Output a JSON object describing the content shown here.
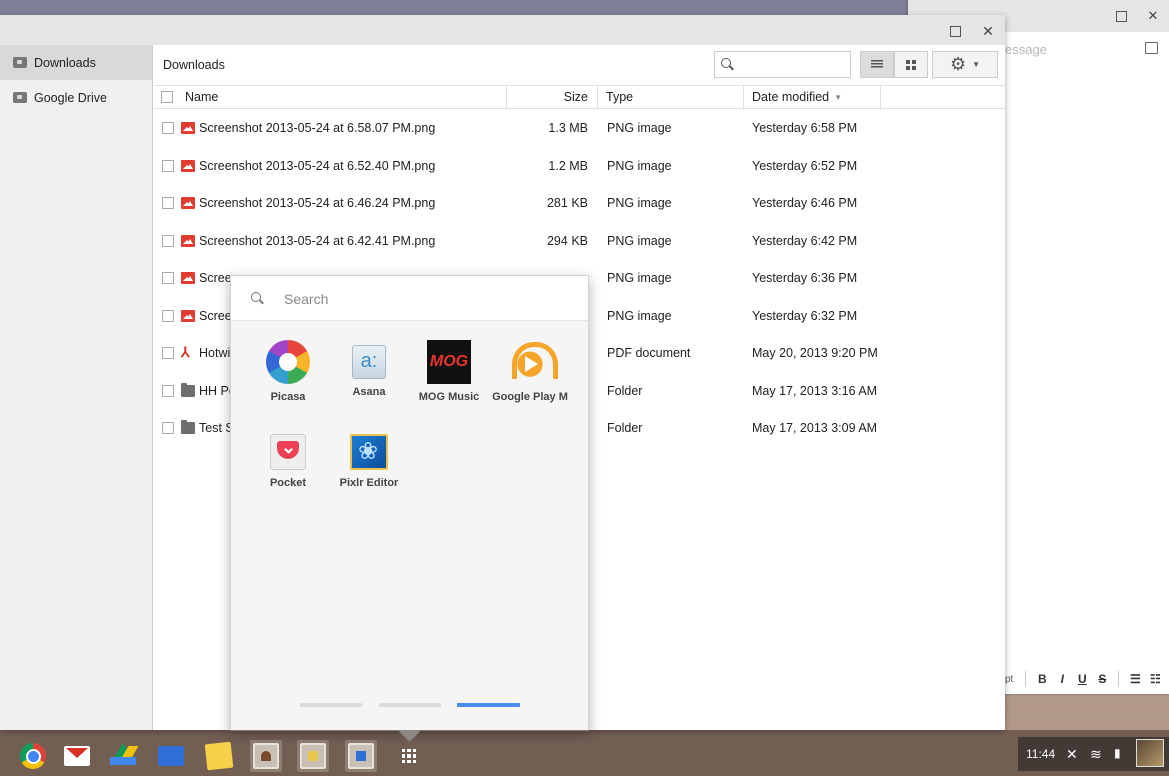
{
  "compose_window": {
    "placeholder": "essage",
    "font_size_label": "pt",
    "format_buttons": [
      "B",
      "I",
      "U",
      "S"
    ]
  },
  "file_manager": {
    "sidebar": {
      "items": [
        {
          "label": "Downloads",
          "active": true,
          "icon": "download-folder-icon"
        },
        {
          "label": "Google Drive",
          "active": false,
          "icon": "drive-folder-icon"
        }
      ]
    },
    "breadcrumb": "Downloads",
    "search": {
      "value": "",
      "placeholder": ""
    },
    "columns": {
      "name": "Name",
      "size": "Size",
      "type": "Type",
      "date": "Date modified"
    },
    "files": [
      {
        "name": "Screenshot 2013-05-24 at 6.58.07 PM.png",
        "size": "1.3 MB",
        "type": "PNG image",
        "date": "Yesterday 6:58 PM",
        "icon": "image"
      },
      {
        "name": "Screenshot 2013-05-24 at 6.52.40 PM.png",
        "size": "1.2 MB",
        "type": "PNG image",
        "date": "Yesterday 6:52 PM",
        "icon": "image"
      },
      {
        "name": "Screenshot 2013-05-24 at 6.46.24 PM.png",
        "size": "281 KB",
        "type": "PNG image",
        "date": "Yesterday 6:46 PM",
        "icon": "image"
      },
      {
        "name": "Screenshot 2013-05-24 at 6.42.41 PM.png",
        "size": "294 KB",
        "type": "PNG image",
        "date": "Yesterday 6:42 PM",
        "icon": "image"
      },
      {
        "name": "Scree",
        "size": "",
        "type": "PNG image",
        "date": "Yesterday 6:36 PM",
        "icon": "image"
      },
      {
        "name": "Scree",
        "size": "",
        "type": "PNG image",
        "date": "Yesterday 6:32 PM",
        "icon": "image"
      },
      {
        "name": "Hotwi",
        "size": "",
        "type": "PDF document",
        "date": "May 20, 2013 9:20 PM",
        "icon": "pdf"
      },
      {
        "name": "HH Po",
        "size": "",
        "type": "Folder",
        "date": "May 17, 2013 3:16 AM",
        "icon": "folder"
      },
      {
        "name": "Test S",
        "size": "",
        "type": "Folder",
        "date": "May 17, 2013 3:09 AM",
        "icon": "folder"
      }
    ]
  },
  "launcher": {
    "search_placeholder": "Search",
    "apps": [
      {
        "label": "Picasa",
        "icon": "picasa-icon"
      },
      {
        "label": "Asana",
        "icon": "asana-icon",
        "glyph": "a:"
      },
      {
        "label": "MOG Music",
        "icon": "mog-icon",
        "glyph": "MOG"
      },
      {
        "label": "Google Play M",
        "icon": "google-play-music-icon"
      },
      {
        "label": "Pocket",
        "icon": "pocket-icon"
      },
      {
        "label": "Pixlr Editor",
        "icon": "pixlr-icon"
      }
    ],
    "pages": 3,
    "active_page": 3,
    "colors": {
      "active_page": "#4a8af4",
      "inactive_page": "#dcdcdc"
    }
  },
  "shelf": {
    "apps": [
      "chrome-icon",
      "gmail-icon",
      "google-drive-icon",
      "files-icon",
      "notes-icon",
      "window-thumb-icon",
      "window-thumb-icon",
      "files-window-icon",
      "app-launcher-icon"
    ]
  },
  "tray": {
    "time": "11:44"
  }
}
